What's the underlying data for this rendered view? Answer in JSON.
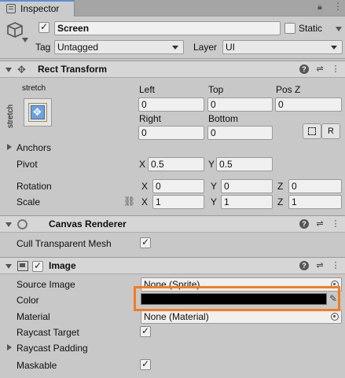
{
  "tab": {
    "title": "Inspector"
  },
  "header": {
    "object_name": "Screen",
    "static_label": "Static",
    "tag_label": "Tag",
    "tag_value": "Untagged",
    "layer_label": "Layer",
    "layer_value": "UI"
  },
  "rect_transform": {
    "title": "Rect Transform",
    "anchor_preset_top": "stretch",
    "anchor_preset_side": "stretch",
    "left_label": "Left",
    "left_value": "0",
    "top_label": "Top",
    "top_value": "0",
    "posz_label": "Pos Z",
    "posz_value": "0",
    "right_label": "Right",
    "right_value": "0",
    "bottom_label": "Bottom",
    "bottom_value": "0",
    "raw_edit_label": "R",
    "anchors_label": "Anchors",
    "pivot_label": "Pivot",
    "pivot_x_label": "X",
    "pivot_x": "0.5",
    "pivot_y_label": "Y",
    "pivot_y": "0.5",
    "rotation_label": "Rotation",
    "rot_x_label": "X",
    "rot_x": "0",
    "rot_y_label": "Y",
    "rot_y": "0",
    "rot_z_label": "Z",
    "rot_z": "0",
    "scale_label": "Scale",
    "scale_x_label": "X",
    "scale_x": "1",
    "scale_y_label": "Y",
    "scale_y": "1",
    "scale_z_label": "Z",
    "scale_z": "1"
  },
  "canvas_renderer": {
    "title": "Canvas Renderer",
    "cull_label": "Cull Transparent Mesh"
  },
  "image": {
    "title": "Image",
    "source_image_label": "Source Image",
    "source_image_value": "None (Sprite)",
    "color_label": "Color",
    "material_label": "Material",
    "material_value": "None (Material)",
    "raycast_target_label": "Raycast Target",
    "raycast_padding_label": "Raycast Padding",
    "maskable_label": "Maskable"
  },
  "colors": {
    "highlight": "#f57c1f",
    "color_swatch": "#000000",
    "tab_accent": "#5c8fd6"
  }
}
